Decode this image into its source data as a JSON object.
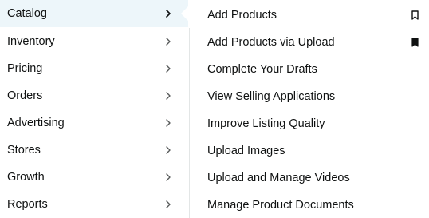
{
  "left_menu": {
    "items": [
      {
        "label": "Catalog",
        "active": true,
        "icon": "chevron-right-icon"
      },
      {
        "label": "Inventory",
        "active": false,
        "icon": "chevron-right-icon"
      },
      {
        "label": "Pricing",
        "active": false,
        "icon": "chevron-right-icon"
      },
      {
        "label": "Orders",
        "active": false,
        "icon": "chevron-right-icon"
      },
      {
        "label": "Advertising",
        "active": false,
        "icon": "chevron-right-icon"
      },
      {
        "label": "Stores",
        "active": false,
        "icon": "chevron-right-icon"
      },
      {
        "label": "Growth",
        "active": false,
        "icon": "chevron-right-icon"
      },
      {
        "label": "Reports",
        "active": false,
        "icon": "chevron-right-icon"
      }
    ]
  },
  "submenu": {
    "items": [
      {
        "label": "Add Products",
        "bookmark": "outline",
        "icon": "bookmark-outline-icon"
      },
      {
        "label": "Add Products via Upload",
        "bookmark": "filled",
        "icon": "bookmark-filled-icon"
      },
      {
        "label": "Complete Your Drafts",
        "bookmark": "none"
      },
      {
        "label": "View Selling Applications",
        "bookmark": "none"
      },
      {
        "label": "Improve Listing Quality",
        "bookmark": "none"
      },
      {
        "label": "Upload Images",
        "bookmark": "none"
      },
      {
        "label": "Upload and Manage Videos",
        "bookmark": "none"
      },
      {
        "label": "Manage Product Documents",
        "bookmark": "none"
      }
    ]
  },
  "colors": {
    "active_bg": "#edf6fa",
    "text": "#0f1111",
    "chevron": "#565959",
    "divider": "#e3e6e6",
    "bookmark": "#0f1111"
  }
}
